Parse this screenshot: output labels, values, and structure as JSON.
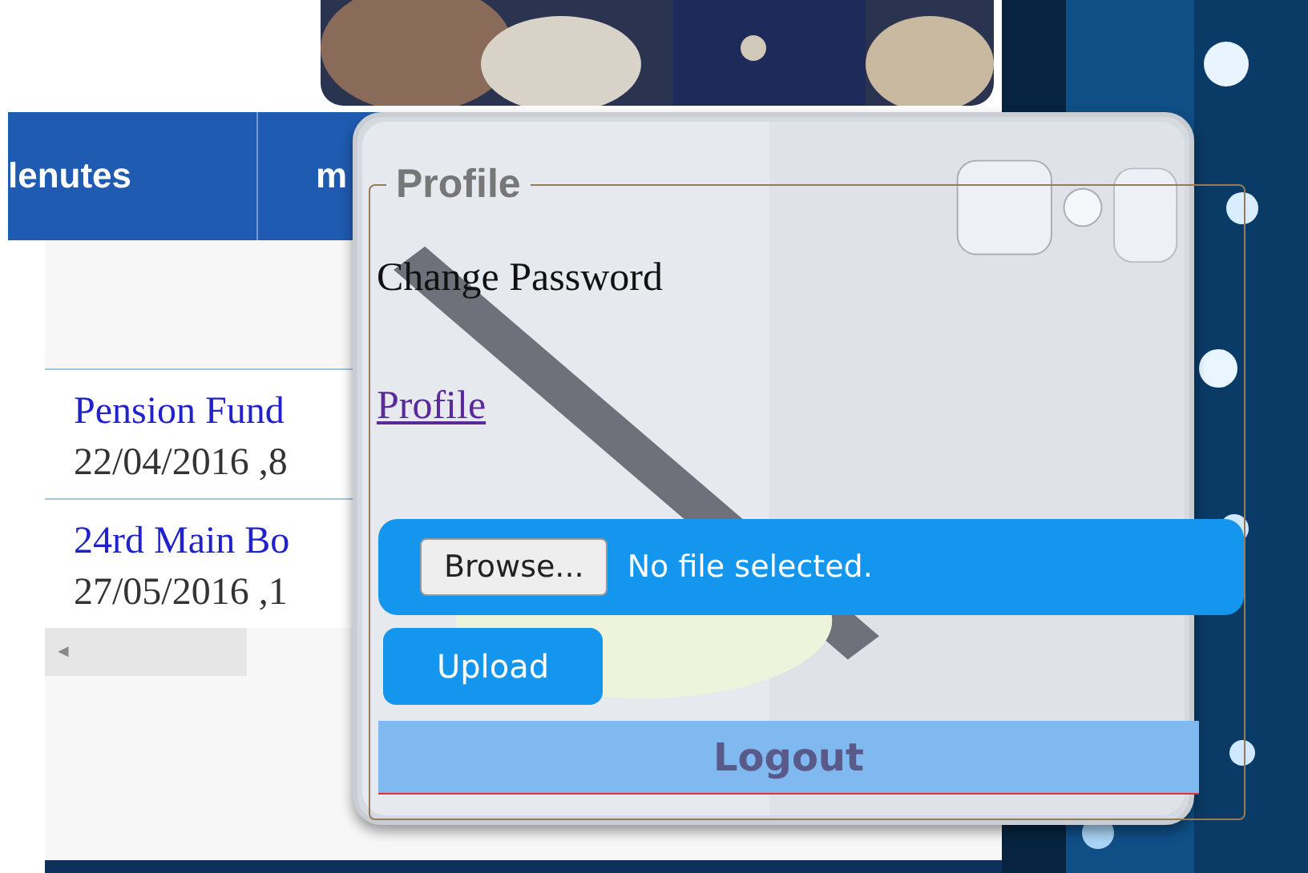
{
  "nav": {
    "tabs": [
      {
        "label": "lenutes"
      },
      {
        "label": "m"
      }
    ]
  },
  "meetings": [
    {
      "title": "Pension Fund",
      "date": "22/04/2016 ,8"
    },
    {
      "title": "24rd Main Bo",
      "date": "27/05/2016 ,1"
    }
  ],
  "scrollbar": {
    "arrow": "◄"
  },
  "profile_popup": {
    "legend": "Profile",
    "change_password": "Change Password",
    "profile_link": "Profile",
    "file_button": "Browse...",
    "file_status": "No file selected.",
    "upload_button": "Upload",
    "logout": "Logout"
  }
}
